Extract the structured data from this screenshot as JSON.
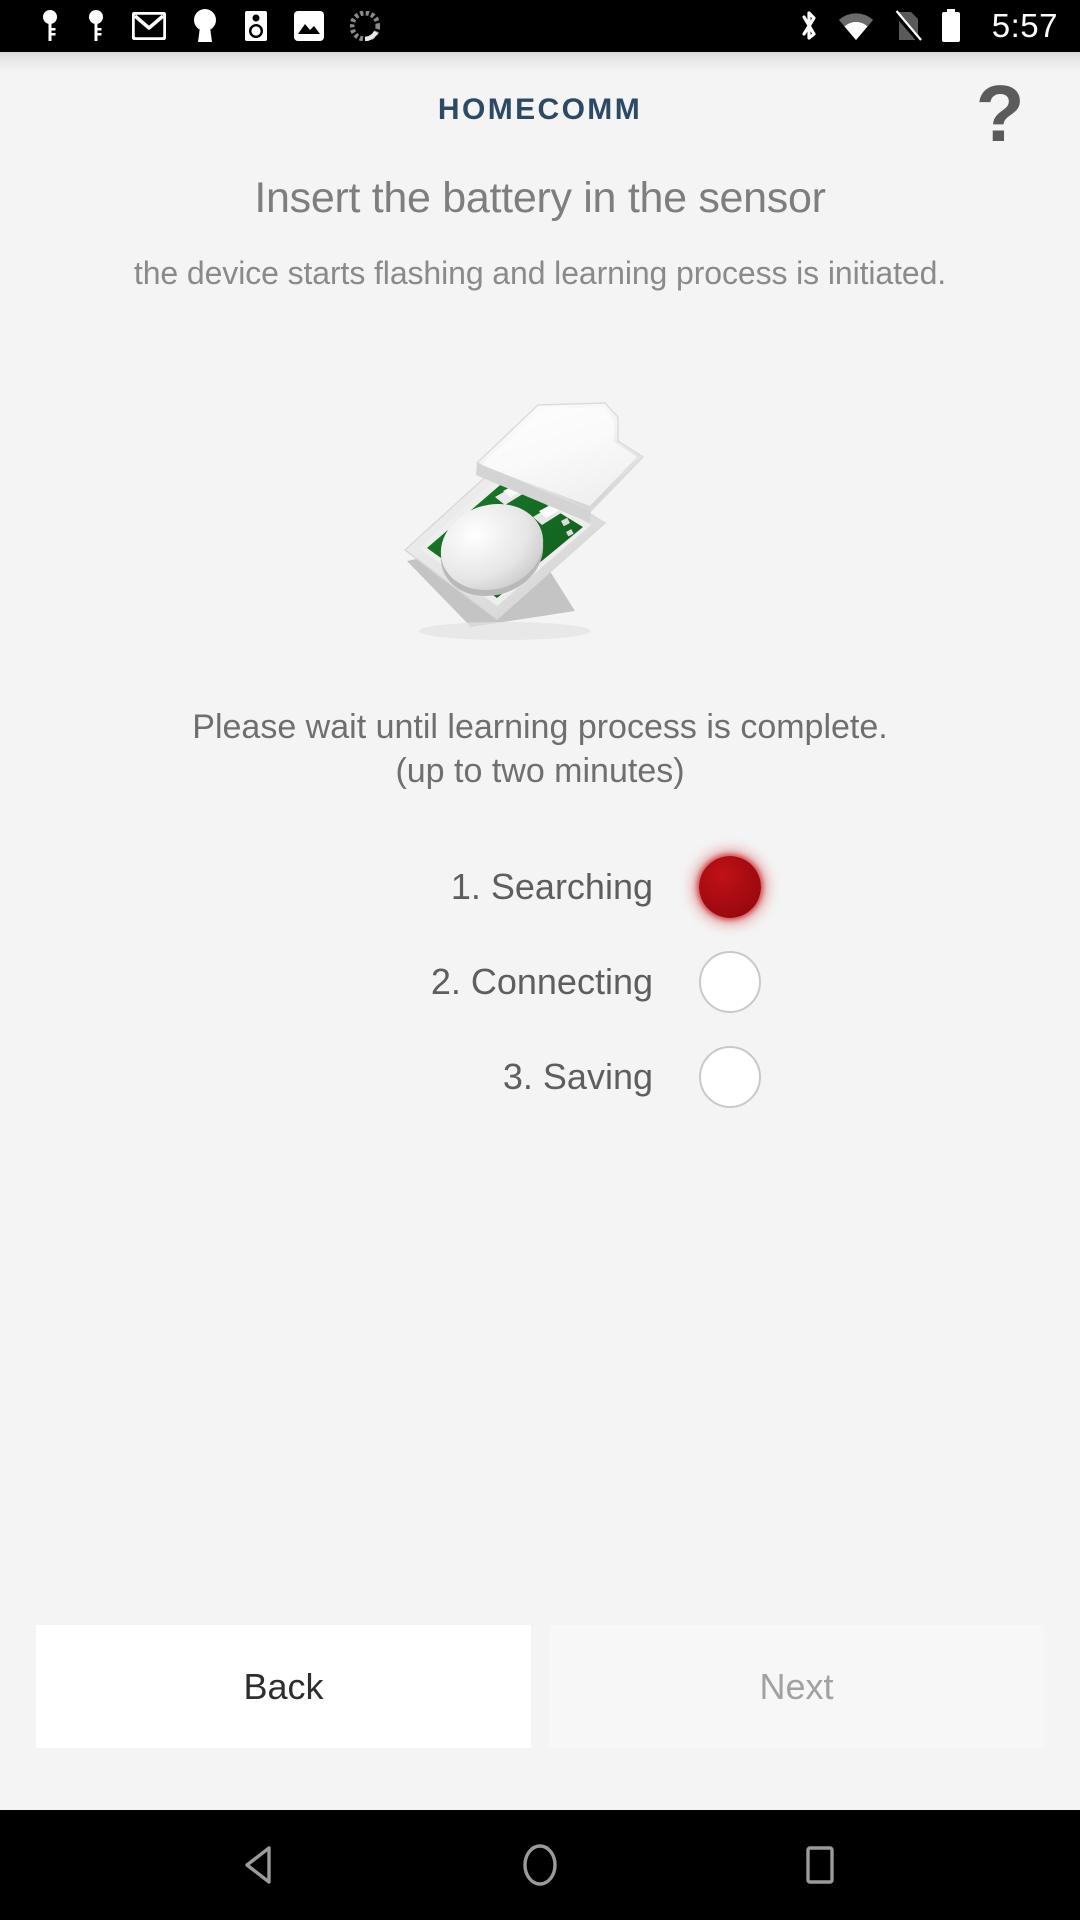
{
  "status_bar": {
    "time": "5:57",
    "left_icons": [
      {
        "name": "key-icon-1"
      },
      {
        "name": "key-icon-2"
      },
      {
        "name": "gmail-icon"
      },
      {
        "name": "keyhole-icon"
      },
      {
        "name": "speaker-icon"
      },
      {
        "name": "photo-icon"
      },
      {
        "name": "sync-spinner-icon"
      }
    ],
    "right_icons": [
      {
        "name": "bluetooth-icon"
      },
      {
        "name": "wifi-icon"
      },
      {
        "name": "no-sim-icon"
      },
      {
        "name": "battery-full-icon"
      }
    ]
  },
  "header": {
    "app_name": "HOMECOMM",
    "app_name_color": "#2c4a63",
    "help_glyph": "?"
  },
  "main": {
    "title": "Insert the battery in the sensor",
    "subtitle": "the device starts flashing and learning process is initiated.",
    "illustration_name": "sensor-with-coin-battery-illustration",
    "wait_line1": "Please wait until learning process is complete.",
    "wait_line2": "(up to two minutes)",
    "steps": [
      {
        "label": "1. Searching",
        "state": "active",
        "led_color": "#a80c12"
      },
      {
        "label": "2. Connecting",
        "state": "inactive",
        "led_color": "#ffffff"
      },
      {
        "label": "3. Saving",
        "state": "inactive",
        "led_color": "#ffffff"
      }
    ]
  },
  "footer": {
    "back_label": "Back",
    "next_label": "Next",
    "next_enabled": false
  },
  "nav_bar": {
    "back": "back-triangle-icon",
    "home": "home-circle-icon",
    "recents": "recents-square-icon"
  }
}
